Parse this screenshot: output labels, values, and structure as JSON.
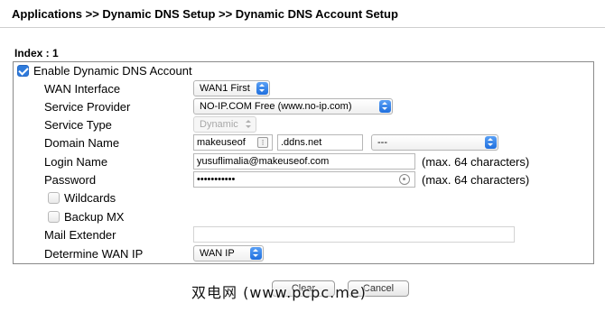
{
  "breadcrumb": "Applications >> Dynamic DNS Setup >> Dynamic DNS Account Setup",
  "index_label": "Index : 1",
  "enable": {
    "label": "Enable Dynamic DNS Account",
    "checked": true
  },
  "fields": {
    "wan_interface": {
      "label": "WAN Interface",
      "value": "WAN1 First"
    },
    "service_provider": {
      "label": "Service Provider",
      "value": "NO-IP.COM Free (www.no-ip.com)"
    },
    "service_type": {
      "label": "Service Type",
      "value": "Dynamic"
    },
    "domain_name": {
      "label": "Domain Name",
      "value": "makeuseof",
      "suffix": ".ddns.net",
      "extra_value": "---"
    },
    "login_name": {
      "label": "Login Name",
      "value": "yusuflimalia@makeuseof.com",
      "hint": "(max. 64 characters)"
    },
    "password": {
      "label": "Password",
      "value": "•••••••••••",
      "hint": "(max. 64 characters)"
    },
    "wildcards": {
      "label": "Wildcards",
      "checked": false
    },
    "backup_mx": {
      "label": "Backup MX",
      "checked": false
    },
    "mail_extender": {
      "label": "Mail Extender",
      "value": ""
    },
    "determine_wan_ip": {
      "label": "Determine WAN IP",
      "value": "WAN IP"
    }
  },
  "buttons": {
    "ok": "Clear",
    "cancel": "Cancel"
  },
  "watermark": "双电网 (www.pcpc.me)",
  "colors": {
    "checkbox_accent": "#2f7bdc",
    "select_button": "#1f6fde",
    "panel_border": "#8a8a8a"
  }
}
